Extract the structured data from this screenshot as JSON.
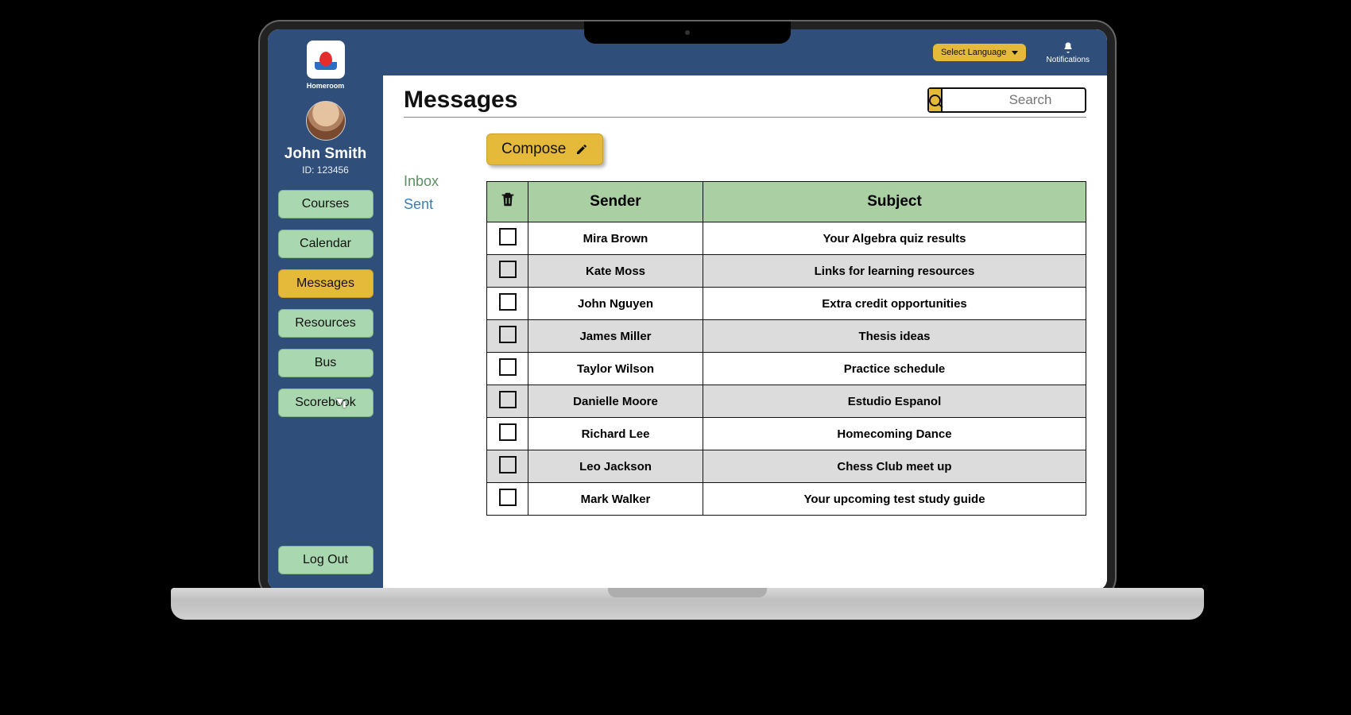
{
  "brand": {
    "name": "Homeroom"
  },
  "user": {
    "name": "John Smith",
    "id_label": "ID: 123456"
  },
  "sidebar": {
    "items": [
      {
        "label": "Courses",
        "active": false
      },
      {
        "label": "Calendar",
        "active": false
      },
      {
        "label": "Messages",
        "active": true
      },
      {
        "label": "Resources",
        "active": false
      },
      {
        "label": "Bus",
        "active": false
      },
      {
        "label": "Scorebook",
        "active": false
      }
    ],
    "logout_label": "Log Out"
  },
  "topbar": {
    "language_label": "Select Language",
    "notifications_label": "Notifications"
  },
  "page": {
    "title": "Messages",
    "search_placeholder": "Search"
  },
  "folders": {
    "inbox": "Inbox",
    "sent": "Sent",
    "active": "inbox"
  },
  "compose_label": "Compose",
  "table": {
    "headers": {
      "sender": "Sender",
      "subject": "Subject"
    },
    "rows": [
      {
        "sender": "Mira Brown",
        "subject": "Your Algebra quiz results"
      },
      {
        "sender": "Kate Moss",
        "subject": "Links for learning resources"
      },
      {
        "sender": "John Nguyen",
        "subject": "Extra credit opportunities"
      },
      {
        "sender": "James Miller",
        "subject": "Thesis ideas"
      },
      {
        "sender": "Taylor Wilson",
        "subject": "Practice schedule"
      },
      {
        "sender": "Danielle Moore",
        "subject": "Estudio Espanol"
      },
      {
        "sender": "Richard Lee",
        "subject": "Homecoming Dance"
      },
      {
        "sender": "Leo Jackson",
        "subject": "Chess Club meet up"
      },
      {
        "sender": "Mark Walker",
        "subject": "Your upcoming test study guide"
      }
    ]
  }
}
